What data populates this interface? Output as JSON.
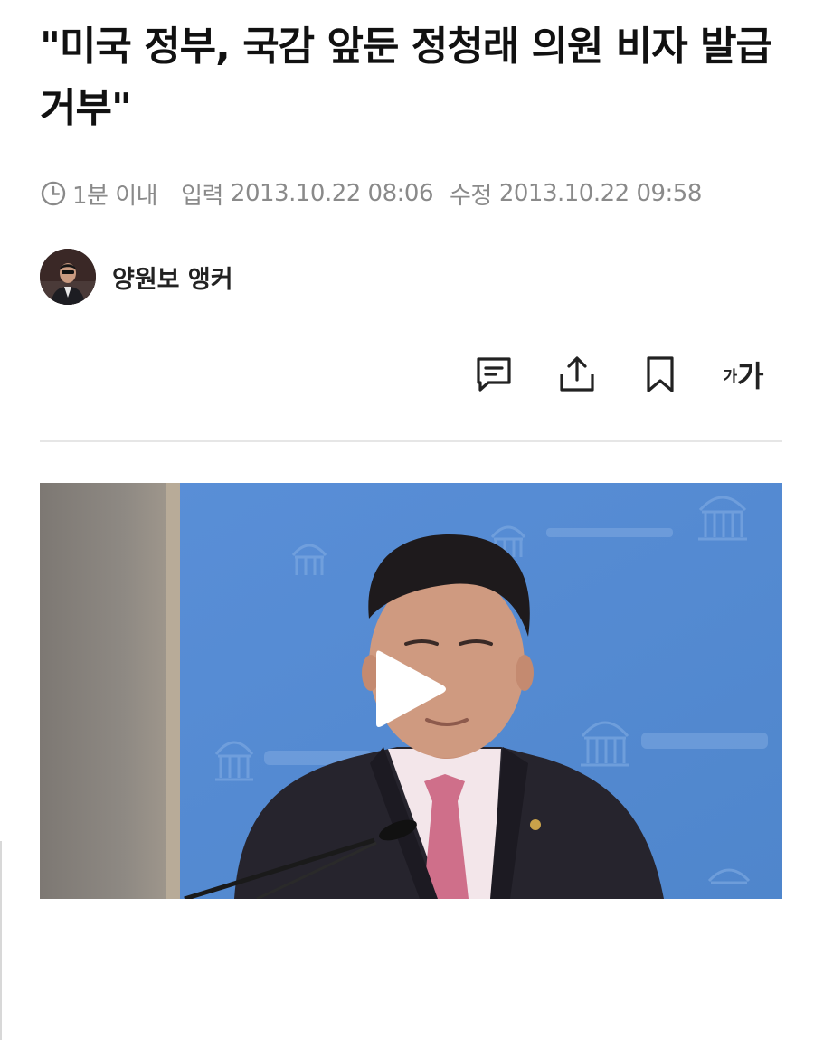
{
  "article": {
    "headline": "\"미국 정부, 국감 앞둔 정청래 의원 비자 발급 거부\"",
    "read_time": "1분 이내",
    "input_label": "입력",
    "input_time": "2013.10.22 08:06",
    "modified_label": "수정",
    "modified_time": "2013.10.22 09:58",
    "reporter": "양원보 앵커"
  },
  "actions": {
    "font_small": "가",
    "font_large": "가",
    "icons": [
      "comment-icon",
      "share-icon",
      "bookmark-icon",
      "font-size-icon"
    ]
  },
  "colors": {
    "text": "#111111",
    "meta": "#8a8a8a",
    "divider": "#e6e6e6",
    "video_backdrop": "#5a8fd3"
  }
}
